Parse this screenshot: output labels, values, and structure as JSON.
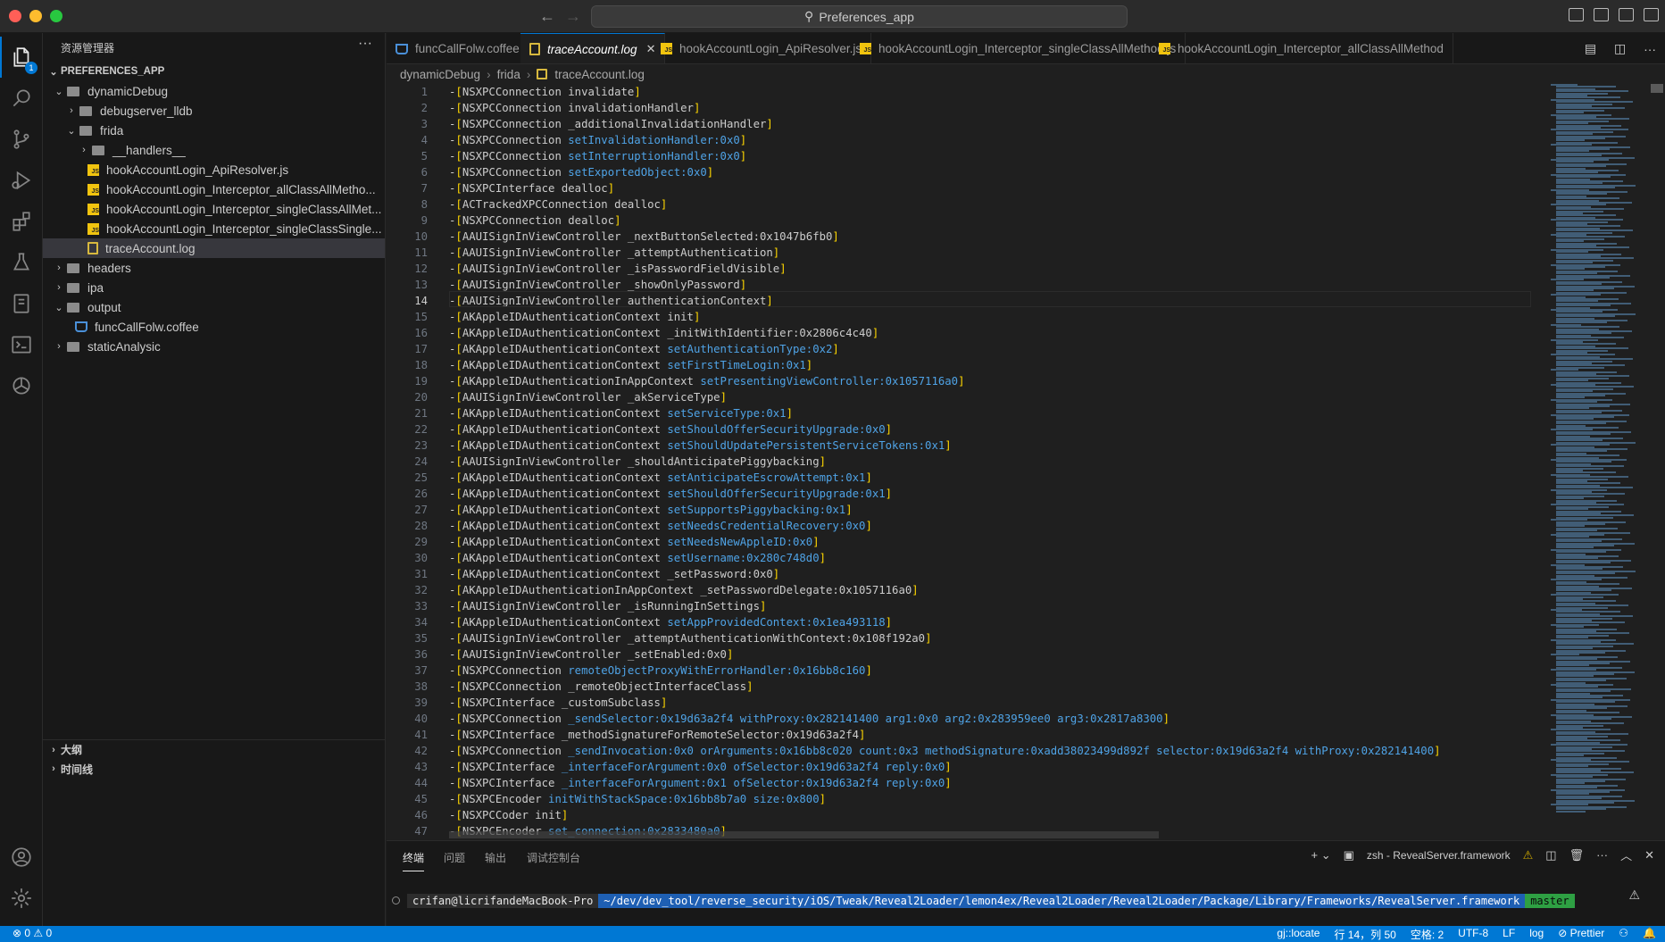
{
  "window": {
    "search_text": "Preferences_app"
  },
  "activity_bar": {
    "items": [
      "explorer-icon",
      "search-icon",
      "source-control-icon",
      "run-debug-icon",
      "extensions-icon",
      "testing-icon",
      "remote-explorer-icon",
      "terminal-icon",
      "openai-icon"
    ],
    "explorer_badge": "1"
  },
  "sidebar": {
    "title": "资源管理器",
    "root": "PREFERENCES_APP",
    "tree": [
      {
        "label": "dynamicDebug",
        "type": "folder",
        "expanded": true,
        "depth": 0
      },
      {
        "label": "debugserver_lldb",
        "type": "folder",
        "expanded": false,
        "depth": 1
      },
      {
        "label": "frida",
        "type": "folder",
        "expanded": true,
        "depth": 1
      },
      {
        "label": "__handlers__",
        "type": "folder",
        "expanded": false,
        "depth": 2
      },
      {
        "label": "hookAccountLogin_ApiResolver.js",
        "type": "js",
        "depth": 2
      },
      {
        "label": "hookAccountLogin_Interceptor_allClassAllMetho...",
        "type": "js",
        "depth": 2
      },
      {
        "label": "hookAccountLogin_Interceptor_singleClassAllMet...",
        "type": "js",
        "depth": 2
      },
      {
        "label": "hookAccountLogin_Interceptor_singleClassSingle...",
        "type": "js",
        "depth": 2
      },
      {
        "label": "traceAccount.log",
        "type": "log",
        "depth": 2,
        "selected": true
      },
      {
        "label": "headers",
        "type": "folder",
        "expanded": false,
        "depth": 0
      },
      {
        "label": "ipa",
        "type": "folder",
        "expanded": false,
        "depth": 0
      },
      {
        "label": "output",
        "type": "folder",
        "expanded": true,
        "depth": 0
      },
      {
        "label": "funcCallFolw.coffee",
        "type": "coffee",
        "depth": 1
      },
      {
        "label": "staticAnalysic",
        "type": "folder",
        "expanded": false,
        "depth": 0
      }
    ],
    "outline_label": "大纲",
    "timeline_label": "时间线"
  },
  "tabs": [
    {
      "label": "funcCallFolw.coffee",
      "icon": "coffee",
      "pinned": true
    },
    {
      "label": "traceAccount.log",
      "icon": "log",
      "active": true
    },
    {
      "label": "hookAccountLogin_ApiResolver.js",
      "icon": "js"
    },
    {
      "label": "hookAccountLogin_Interceptor_singleClassAllMethod.js",
      "icon": "js"
    },
    {
      "label": "hookAccountLogin_Interceptor_allClassAllMethod",
      "icon": "js"
    }
  ],
  "breadcrumb": [
    "dynamicDebug",
    "frida",
    "traceAccount.log"
  ],
  "editor": {
    "current_line": 14,
    "lines": [
      [
        "NSXPCConnection",
        " invalidate",
        ""
      ],
      [
        "NSXPCConnection",
        " invalidationHandler",
        ""
      ],
      [
        "NSXPCConnection",
        " _additionalInvalidationHandler",
        ""
      ],
      [
        "NSXPCConnection",
        " setInvalidationHandler:0x0",
        "s"
      ],
      [
        "NSXPCConnection",
        " setInterruptionHandler:0x0",
        "s"
      ],
      [
        "NSXPCConnection",
        " setExportedObject:0x0",
        "s"
      ],
      [
        "NSXPCInterface",
        " dealloc",
        ""
      ],
      [
        "ACTrackedXPCConnection",
        " dealloc",
        ""
      ],
      [
        "NSXPCConnection",
        " dealloc",
        ""
      ],
      [
        "AAUISignInViewController",
        " _nextButtonSelected:0x1047b6fb0",
        ""
      ],
      [
        "AAUISignInViewController",
        " _attemptAuthentication",
        ""
      ],
      [
        "AAUISignInViewController",
        " _isPasswordFieldVisible",
        ""
      ],
      [
        "AAUISignInViewController",
        " _showOnlyPassword",
        ""
      ],
      [
        "AAUISignInViewController",
        " authenticationContext",
        ""
      ],
      [
        "AKAppleIDAuthenticationContext",
        " init",
        ""
      ],
      [
        "AKAppleIDAuthenticationContext",
        " _initWithIdentifier:0x2806c4c40",
        ""
      ],
      [
        "AKAppleIDAuthenticationContext",
        " setAuthenticationType:0x2",
        "s"
      ],
      [
        "AKAppleIDAuthenticationContext",
        " setFirstTimeLogin:0x1",
        "s"
      ],
      [
        "AKAppleIDAuthenticationInAppContext",
        " setPresentingViewController:0x1057116a0",
        "s"
      ],
      [
        "AAUISignInViewController",
        " _akServiceType",
        ""
      ],
      [
        "AKAppleIDAuthenticationContext",
        " setServiceType:0x1",
        "s"
      ],
      [
        "AKAppleIDAuthenticationContext",
        " setShouldOfferSecurityUpgrade:0x0",
        "s"
      ],
      [
        "AKAppleIDAuthenticationContext",
        " setShouldUpdatePersistentServiceTokens:0x1",
        "s"
      ],
      [
        "AAUISignInViewController",
        " _shouldAnticipatePiggybacking",
        ""
      ],
      [
        "AKAppleIDAuthenticationContext",
        " setAnticipateEscrowAttempt:0x1",
        "s"
      ],
      [
        "AKAppleIDAuthenticationContext",
        " setShouldOfferSecurityUpgrade:0x1",
        "s"
      ],
      [
        "AKAppleIDAuthenticationContext",
        " setSupportsPiggybacking:0x1",
        "s"
      ],
      [
        "AKAppleIDAuthenticationContext",
        " setNeedsCredentialRecovery:0x0",
        "s"
      ],
      [
        "AKAppleIDAuthenticationContext",
        " setNeedsNewAppleID:0x0",
        "s"
      ],
      [
        "AKAppleIDAuthenticationContext",
        " setUsername:0x280c748d0",
        "s"
      ],
      [
        "AKAppleIDAuthenticationContext",
        " _setPassword:0x0",
        ""
      ],
      [
        "AKAppleIDAuthenticationInAppContext",
        " _setPasswordDelegate:0x1057116a0",
        ""
      ],
      [
        "AAUISignInViewController",
        " _isRunningInSettings",
        ""
      ],
      [
        "AKAppleIDAuthenticationContext",
        " setAppProvidedContext:0x1ea493118",
        "s"
      ],
      [
        "AAUISignInViewController",
        " _attemptAuthenticationWithContext:0x108f192a0",
        ""
      ],
      [
        "AAUISignInViewController",
        " _setEnabled:0x0",
        ""
      ],
      [
        "NSXPCConnection",
        " remoteObjectProxyWithErrorHandler:0x16bb8c160",
        "s"
      ],
      [
        "NSXPCConnection",
        " _remoteObjectInterfaceClass",
        ""
      ],
      [
        "NSXPCInterface",
        " _customSubclass",
        ""
      ],
      [
        "NSXPCConnection",
        " _sendSelector:0x19d63a2f4 withProxy:0x282141400 arg1:0x0 arg2:0x283959ee0 arg3:0x2817a8300",
        "m"
      ],
      [
        "NSXPCInterface",
        " _methodSignatureForRemoteSelector:0x19d63a2f4",
        ""
      ],
      [
        "NSXPCConnection",
        " _sendInvocation:0x0 orArguments:0x16bb8c020 count:0x3 methodSignature:0xadd38023499d892f selector:0x19d63a2f4 withProxy:0x282141400",
        "m"
      ],
      [
        "NSXPCInterface",
        " _interfaceForArgument:0x0 ofSelector:0x19d63a2f4 reply:0x0",
        "m"
      ],
      [
        "NSXPCInterface",
        " _interfaceForArgument:0x1 ofSelector:0x19d63a2f4 reply:0x0",
        "m"
      ],
      [
        "NSXPCEncoder",
        " initWithStackSpace:0x16bb8b7a0 size:0x800",
        "s"
      ],
      [
        "NSXPCCoder",
        " init",
        ""
      ],
      [
        "NSXPCEncoder",
        " set_connection:0x2833480a0",
        "s"
      ]
    ]
  },
  "panel": {
    "tabs": [
      "终端",
      "问题",
      "输出",
      "调试控制台"
    ],
    "terminal_label": "zsh - RevealServer.framework",
    "prompt_user": "crifan@licrifandeMacBook-Pro",
    "prompt_path": "~/dev/dev_tool/reverse_security/iOS/Tweak/Reveal2Loader/lemon4ex/Reveal2Loader/Reveal2Loader/Package/Library/Frameworks/RevealServer.framework",
    "prompt_branch": " master"
  },
  "statusbar": {
    "problems": "⊗ 0 ⚠ 0",
    "right_items": [
      "gj::locate",
      "行 14，列 50",
      "空格: 2",
      "UTF-8",
      "LF",
      "log",
      "⊘ Prettier"
    ]
  },
  "colors": {
    "accent": "#0078d4",
    "bracket": "#ffd700",
    "selector": "#4fa3e6"
  }
}
